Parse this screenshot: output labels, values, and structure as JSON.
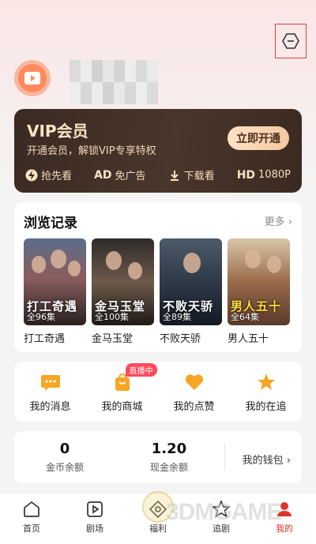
{
  "vip": {
    "title": "VIP会员",
    "subtitle": "开通会员，解锁VIP专享特权",
    "cta": "立即开通",
    "perks": [
      {
        "tag": "",
        "label": "抢先看",
        "icon": "lightning-icon"
      },
      {
        "tag": "AD",
        "label": "免广告",
        "icon": ""
      },
      {
        "tag": "",
        "label": "下载看",
        "icon": "download-icon"
      },
      {
        "tag": "HD",
        "label": "1080P",
        "icon": ""
      }
    ]
  },
  "history": {
    "title": "浏览记录",
    "more": "更多",
    "items": [
      {
        "name": "打工奇遇",
        "poster_text": "打工奇遇",
        "episodes": "全96集"
      },
      {
        "name": "金马玉堂",
        "poster_text": "金马玉堂",
        "episodes": "全100集"
      },
      {
        "name": "不败天骄",
        "poster_text": "不败天骄",
        "episodes": "全89集"
      },
      {
        "name": "男人五十",
        "poster_text": "男人五十",
        "episodes": "全64集"
      }
    ]
  },
  "shortcuts": {
    "live_badge": "直播中",
    "items": [
      {
        "label": "我的消息",
        "icon": "message-icon"
      },
      {
        "label": "我的商城",
        "icon": "shopping-bag-icon"
      },
      {
        "label": "我的点赞",
        "icon": "heart-icon"
      },
      {
        "label": "我的在追",
        "icon": "star-icon"
      }
    ]
  },
  "wallet": {
    "coins_value": "0",
    "coins_label": "金币余额",
    "cash_value": "1.20",
    "cash_label": "现金余额",
    "link": "我的钱包"
  },
  "tabs": [
    {
      "label": "首页",
      "icon": "home-icon"
    },
    {
      "label": "剧场",
      "icon": "play-icon"
    },
    {
      "label": "福利",
      "icon": "gift-icon"
    },
    {
      "label": "追剧",
      "icon": "star-icon"
    },
    {
      "label": "我的",
      "icon": "profile-icon"
    }
  ],
  "watermark": "3DMGAME",
  "colors": {
    "accent": "#e2322c",
    "orange": "#f6a623",
    "vip_bg": "#3a2a22",
    "vip_gold": "#f6dcc0"
  }
}
